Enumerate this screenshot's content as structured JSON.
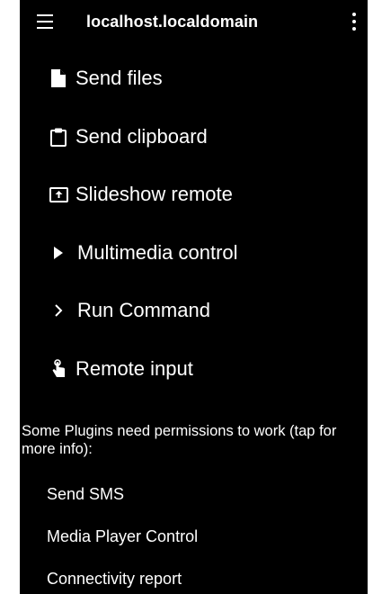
{
  "app_bar": {
    "title": "localhost.localdomain",
    "menu_icon": "hamburger-menu-icon",
    "overflow_icon": "vertical-dots-icon"
  },
  "plugins": [
    {
      "label": "Send files",
      "icon": "file-icon"
    },
    {
      "label": "Send clipboard",
      "icon": "clipboard-icon"
    },
    {
      "label": "Slideshow remote",
      "icon": "presentation-icon"
    },
    {
      "label": "Multimedia control",
      "icon": "play-icon"
    },
    {
      "label": "Run Command",
      "icon": "chevron-right-icon"
    },
    {
      "label": "Remote input",
      "icon": "touch-icon"
    }
  ],
  "permissions_notice": "Some Plugins need permissions to work (tap for more info):",
  "permission_plugins": [
    {
      "label": "Send SMS"
    },
    {
      "label": "Media Player Control"
    },
    {
      "label": "Connectivity report"
    }
  ],
  "colors": {
    "background": "#000000",
    "text": "#ffffff",
    "outer": "#ffffff"
  }
}
